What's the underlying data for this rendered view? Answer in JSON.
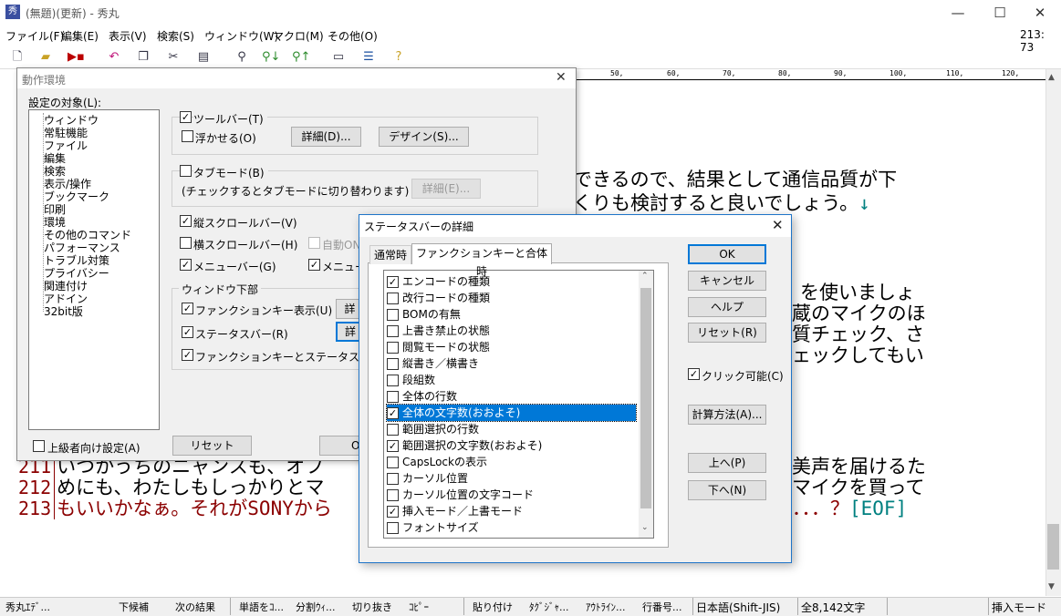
{
  "window": {
    "title": "(無題)(更新) - 秀丸",
    "minimize": "—",
    "maximize": "☐",
    "close": "✕"
  },
  "menu": [
    "ファイル(F)",
    "編集(E)",
    "表示(V)",
    "検索(S)",
    "ウィンドウ(W)",
    "マクロ(M)",
    "その他(O)"
  ],
  "cursor_pos": "213: 73",
  "toolbar_icons": [
    "new-file-icon",
    "open-folder-icon",
    "save-icon",
    "undo-icon",
    "copy-icon",
    "cut-icon",
    "paste-icon",
    "search-icon",
    "search-down-icon",
    "search-up-icon",
    "grep-icon",
    "window-split-icon",
    "help-icon"
  ],
  "ruler": {
    "marks": [
      "50,",
      "60,",
      "70,",
      "80,",
      "90,",
      "100,",
      "110,",
      "120,"
    ]
  },
  "editor": {
    "fragments": [
      {
        "text": "できるので、結果として通信品質が下"
      },
      {
        "text": "くりも検討すると良いでしょう。",
        "arrow": "↓"
      },
      {
        "text": "を使いましょ"
      },
      {
        "text": "蔵のマイクのほ"
      },
      {
        "text": "質チェック、さ"
      },
      {
        "text": "ェックしてもい"
      },
      {
        "text": "美声を届けるた"
      },
      {
        "text": "マイクを買って"
      },
      {
        "text": "．．．？",
        "eof": "[EOF]"
      }
    ],
    "lines": [
      {
        "num": "211",
        "text": "いつかうちのニャンスも、オフ"
      },
      {
        "num": "212",
        "text": "めにも、わたしもしっかりとマ"
      },
      {
        "num": "213",
        "text": "もいいかなぁ。それがSONYから"
      }
    ]
  },
  "status_bar": [
    "秀丸ｴﾃﾞ...",
    "下候補",
    "次の結果",
    "単語をｺ...",
    "分割ｳｨ...",
    "切り抜き",
    "ｺﾋﾟｰ",
    "貼り付け",
    "ﾀｸﾞｼﾞｬ...",
    "ｱｳﾄﾗｲﾝ...",
    "行番号...",
    "日本語(Shift-JIS)",
    "全8,142文字",
    "挿入モード"
  ],
  "dialog_env": {
    "title": "動作環境",
    "target_label": "設定の対象(L):",
    "tree": [
      "ウィンドウ",
      "常駐機能",
      "ファイル",
      "編集",
      "検索",
      "表示/操作",
      "ブックマーク",
      "印刷",
      "環境",
      "その他のコマンド",
      "パフォーマンス",
      "トラブル対策",
      "プライバシー",
      "関連付け",
      "アドイン",
      "32bit版"
    ],
    "toolbar_chk": "ツールバー(T)",
    "float_chk": "浮かせる(O)",
    "detail_btn": "詳細(D)...",
    "design_btn": "デザイン(S)...",
    "tabmode_chk": "タブモード(B)",
    "tabmode_note": "(チェックするとタブモードに切り替わります)",
    "tabmode_detail_btn": "詳細(E)...",
    "vscroll_chk": "縦スクロールバー(V)",
    "hscroll_chk": "横スクロールバー(H)",
    "auto_on": "自動ON",
    "menubar_chk": "メニューバー(G)",
    "menubar2_chk": "メニュー",
    "bottom_group": "ウィンドウ下部",
    "fkey_chk": "ファンクションキー表示(U)",
    "status_chk": "ステータスバー(R)",
    "fkey_status_chk": "ファンクションキーとステータスバー",
    "detail_short": "詳",
    "advanced_chk": "上級者向け設定(A)",
    "reset_btn": "リセット",
    "ok_partial": "O"
  },
  "dialog_status": {
    "title": "ステータスバーの詳細",
    "tabs": [
      "通常時",
      "ファンクションキーと合体時"
    ],
    "items": [
      {
        "label": "エンコードの種類",
        "checked": true
      },
      {
        "label": "改行コードの種類",
        "checked": false
      },
      {
        "label": "BOMの有無",
        "checked": false
      },
      {
        "label": "上書き禁止の状態",
        "checked": false
      },
      {
        "label": "閲覧モードの状態",
        "checked": false
      },
      {
        "label": "縦書き／横書き",
        "checked": false
      },
      {
        "label": "段組数",
        "checked": false
      },
      {
        "label": "全体の行数",
        "checked": false
      },
      {
        "label": "全体の文字数(おおよそ)",
        "checked": true,
        "selected": true
      },
      {
        "label": "範囲選択の行数",
        "checked": false
      },
      {
        "label": "範囲選択の文字数(おおよそ)",
        "checked": true
      },
      {
        "label": "CapsLockの表示",
        "checked": false
      },
      {
        "label": "カーソル位置",
        "checked": false
      },
      {
        "label": "カーソル位置の文字コード",
        "checked": false
      },
      {
        "label": "挿入モード／上書モード",
        "checked": true
      },
      {
        "label": "フォントサイズ",
        "checked": false
      }
    ],
    "ok": "OK",
    "cancel": "キャンセル",
    "help": "ヘルプ",
    "reset": "リセット(R)",
    "clickable": "クリック可能(C)",
    "calc": "計算方法(A)...",
    "up": "上へ(P)",
    "down": "下へ(N)"
  }
}
